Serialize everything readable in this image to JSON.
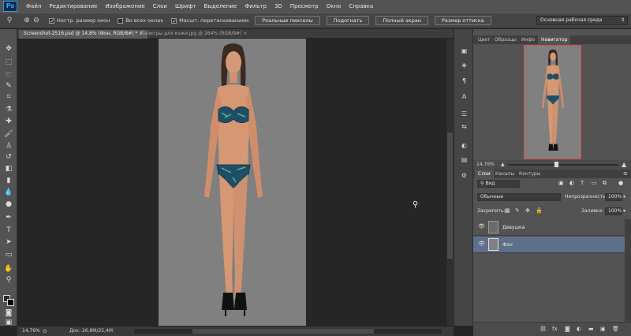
{
  "app": {
    "logo": "Ps"
  },
  "menu": [
    "Файл",
    "Редактирование",
    "Изображение",
    "Слои",
    "Шрифт",
    "Выделение",
    "Фильтр",
    "3D",
    "Просмотр",
    "Окно",
    "Справка"
  ],
  "options_bar": {
    "checkboxes": [
      {
        "label": "Настр. размер окон",
        "checked": true
      },
      {
        "label": "Во всех окнах",
        "checked": false
      },
      {
        "label": "Масшт. перетаскиванием",
        "checked": true
      }
    ],
    "buttons": [
      "Реальные пикселы",
      "Подогнать",
      "Полный экран",
      "Размер оттиска"
    ],
    "workspace": "Основная рабочая среда"
  },
  "tabs": [
    {
      "label": "Screenshot-2516.psd @ 14,8% (Фон, RGB/8#) *",
      "close": "×",
      "active": true
    },
    {
      "label": "Палитры для кожи.jpg @ 264% (RGB/8#)",
      "close": "×",
      "active": false
    }
  ],
  "status": {
    "zoom": "14,76%",
    "doc": "Док: 26,8M/25,4M"
  },
  "navigator": {
    "tabs": [
      "Цвет",
      "Образцы",
      "Инфо",
      "Навигатор"
    ],
    "active_tab": "Навигатор",
    "zoom": "14,76%"
  },
  "layers": {
    "tabs": [
      "Слои",
      "Каналы",
      "Контуры"
    ],
    "active_tab": "Слои",
    "filter": "Вид",
    "blend_mode": "Обычные",
    "opacity_label": "Непрозрачность:",
    "opacity": "100%",
    "lock_label": "Закрепить:",
    "fill_label": "Заливка:",
    "fill": "100%",
    "items": [
      {
        "name": "Девушка",
        "selected": false
      },
      {
        "name": "Фон",
        "selected": true
      }
    ],
    "footer_icons": [
      "fx"
    ]
  },
  "colors": {
    "accent_selected": "#5e6f89",
    "navigator_frame": "#e34a4a"
  }
}
